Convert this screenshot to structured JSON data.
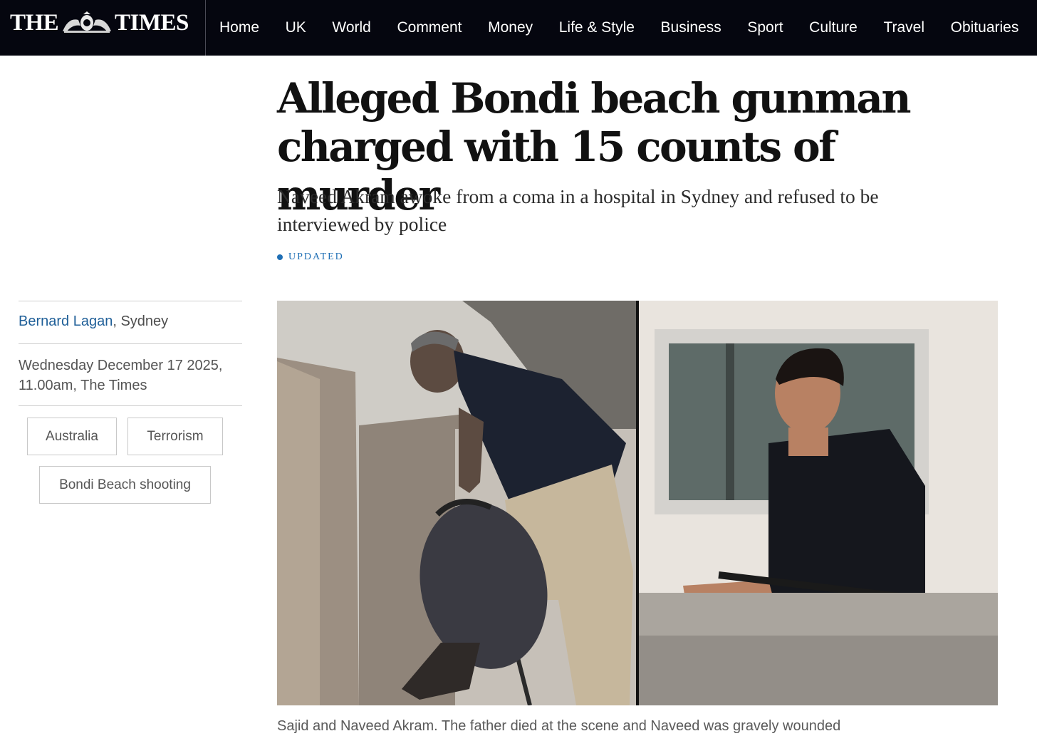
{
  "nav": {
    "logo_left": "THE",
    "logo_right": "TIMES",
    "items": [
      "Home",
      "UK",
      "World",
      "Comment",
      "Money",
      "Life & Style",
      "Business",
      "Sport",
      "Culture",
      "Travel",
      "Obituaries"
    ]
  },
  "article": {
    "headline": "Alleged Bondi beach gunman charged with 15 counts of murder",
    "standfirst": "Naveed Akram awoke from a coma in a hospital in Sydney and refused to be interviewed by police",
    "status": "UPDATED",
    "author": "Bernard Lagan",
    "location": ", Sydney",
    "dateline": "Wednesday December 17 2025, 11.00am, The Times",
    "tags": [
      "Australia",
      "Terrorism",
      "Bondi Beach shooting"
    ],
    "caption": "Sajid and Naveed Akram. The father died at the scene and Naveed was gravely wounded"
  },
  "colors": {
    "nav_background": "#05060f",
    "link_blue": "#1f5f98",
    "updated_blue": "#1f6fb5"
  }
}
